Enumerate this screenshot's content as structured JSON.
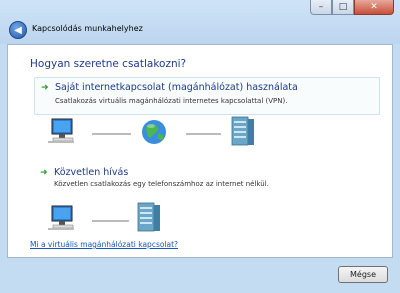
{
  "window": {
    "title": "Kapcsolódás munkahelyhez",
    "min": "–",
    "max": "□",
    "close": "✕"
  },
  "question": "Hogyan szeretne csatlakozni?",
  "options": [
    {
      "title": "Saját internetkapcsolat (magánhálózat) használata",
      "description": "Csatlakozás virtuális magánhálózati internetes kapcsolattal (VPN)."
    },
    {
      "title": "Közvetlen hívás",
      "description": "Közvetlen csatlakozás egy telefonszámhoz az internet nélkül."
    }
  ],
  "help_link": "Mi a virtuális magánhálózati kapcsolat?",
  "buttons": {
    "cancel": "Mégse"
  },
  "icons": {
    "back": "back-arrow-icon",
    "arrow": "green-arrow-icon",
    "computer": "computer-icon",
    "globe": "globe-icon",
    "server": "server-icon"
  }
}
